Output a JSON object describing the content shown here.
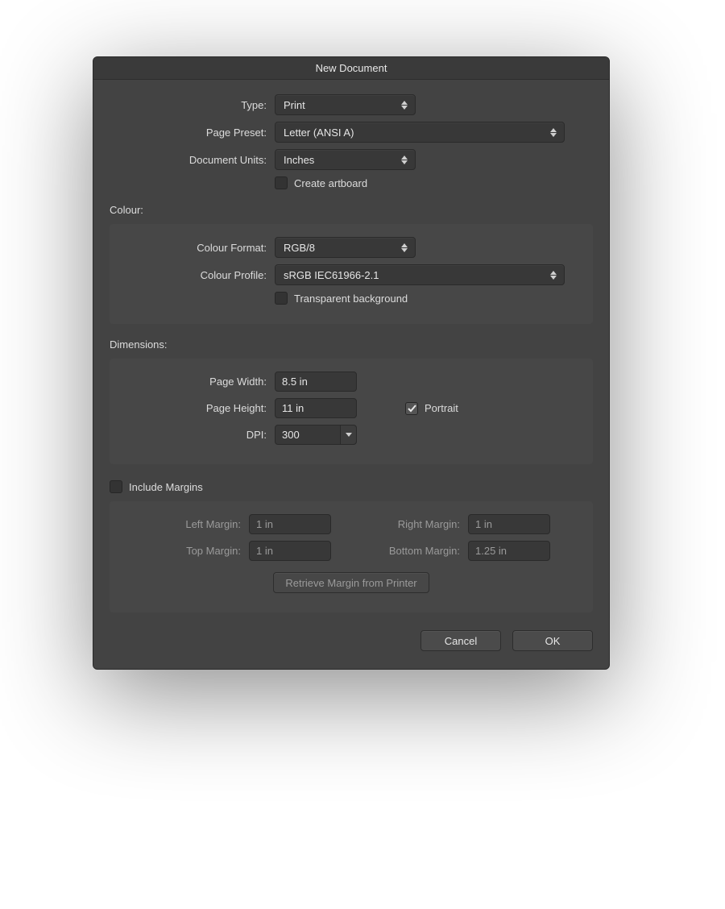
{
  "title": "New Document",
  "fields": {
    "type_label": "Type:",
    "type_value": "Print",
    "page_preset_label": "Page Preset:",
    "page_preset_value": "Letter (ANSI A)",
    "doc_units_label": "Document Units:",
    "doc_units_value": "Inches",
    "create_artboard_label": "Create artboard",
    "create_artboard_checked": false
  },
  "colour": {
    "heading": "Colour:",
    "format_label": "Colour Format:",
    "format_value": "RGB/8",
    "profile_label": "Colour Profile:",
    "profile_value": "sRGB IEC61966-2.1",
    "transparent_label": "Transparent background",
    "transparent_checked": false
  },
  "dimensions": {
    "heading": "Dimensions:",
    "width_label": "Page Width:",
    "width_value": "8.5 in",
    "height_label": "Page Height:",
    "height_value": "11 in",
    "dpi_label": "DPI:",
    "dpi_value": "300",
    "portrait_label": "Portrait",
    "portrait_checked": true
  },
  "margins": {
    "include_label": "Include Margins",
    "include_checked": false,
    "left_label": "Left Margin:",
    "left_value": "1 in",
    "right_label": "Right Margin:",
    "right_value": "1 in",
    "top_label": "Top Margin:",
    "top_value": "1 in",
    "bottom_label": "Bottom Margin:",
    "bottom_value": "1.25 in",
    "retrieve_label": "Retrieve Margin from Printer"
  },
  "footer": {
    "cancel": "Cancel",
    "ok": "OK"
  }
}
